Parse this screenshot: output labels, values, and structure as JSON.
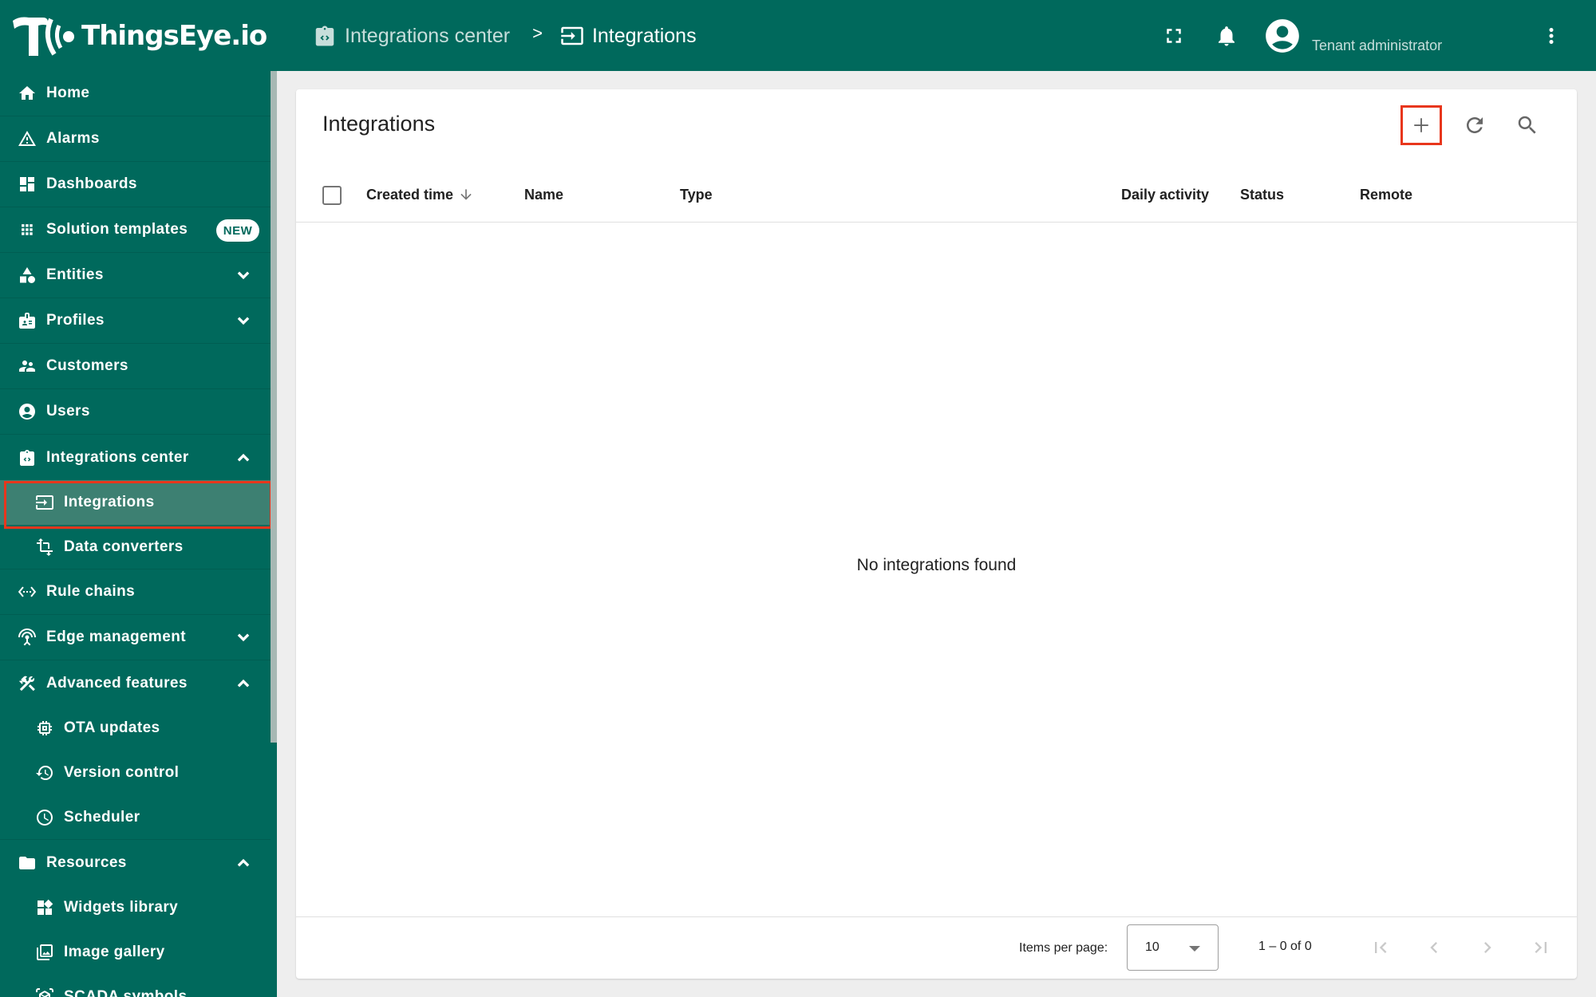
{
  "app": {
    "brand": "ThingsEye.io",
    "accent_color": "#00695c",
    "highlight_color": "#e8361c"
  },
  "header": {
    "breadcrumb": [
      {
        "label": "Integrations center",
        "icon": "integrations-center-icon"
      },
      {
        "label": "Integrations",
        "icon": "input-icon"
      }
    ],
    "separator": ">",
    "user_role": "Tenant administrator",
    "icons": [
      "fullscreen-icon",
      "notifications-bell-icon",
      "account-circle-icon",
      "more-vert-icon"
    ]
  },
  "sidebar": {
    "items": [
      {
        "label": "Home",
        "icon": "home-icon"
      },
      {
        "label": "Alarms",
        "icon": "warning-icon"
      },
      {
        "label": "Dashboards",
        "icon": "dashboard-icon"
      },
      {
        "label": "Solution templates",
        "icon": "apps-icon",
        "badge": "NEW"
      },
      {
        "label": "Entities",
        "icon": "category-icon",
        "expand": "down"
      },
      {
        "label": "Profiles",
        "icon": "badge-icon",
        "expand": "down"
      },
      {
        "label": "Customers",
        "icon": "supervisor-account-icon"
      },
      {
        "label": "Users",
        "icon": "account-circle-icon"
      },
      {
        "label": "Integrations center",
        "icon": "integrations-center-icon",
        "expand": "up"
      },
      {
        "label": "Integrations",
        "icon": "input-icon",
        "sub": true,
        "active": true
      },
      {
        "label": "Data converters",
        "icon": "transform-icon",
        "sub": true
      },
      {
        "label": "Rule chains",
        "icon": "settings-ethernet-icon"
      },
      {
        "label": "Edge management",
        "icon": "settings-input-antenna-icon",
        "expand": "down"
      },
      {
        "label": "Advanced features",
        "icon": "construction-icon",
        "expand": "up"
      },
      {
        "label": "OTA updates",
        "icon": "memory-icon",
        "sub": true
      },
      {
        "label": "Version control",
        "icon": "history-icon",
        "sub": true
      },
      {
        "label": "Scheduler",
        "icon": "schedule-icon",
        "sub": true
      },
      {
        "label": "Resources",
        "icon": "folder-icon",
        "expand": "up"
      },
      {
        "label": "Widgets library",
        "icon": "widgets-icon",
        "sub": true
      },
      {
        "label": "Image gallery",
        "icon": "photo-library-icon",
        "sub": true
      },
      {
        "label": "SCADA symbols",
        "icon": "view-in-ar-icon",
        "sub": true
      }
    ]
  },
  "main": {
    "title": "Integrations",
    "actions": [
      {
        "name": "add",
        "icon": "add-icon"
      },
      {
        "name": "refresh",
        "icon": "refresh-icon"
      },
      {
        "name": "search",
        "icon": "search-icon"
      }
    ],
    "columns": [
      "Created time",
      "Name",
      "Type",
      "Daily activity",
      "Status",
      "Remote"
    ],
    "sort": {
      "column": "Created time",
      "direction": "descending"
    },
    "empty_message": "No integrations found",
    "pagination": {
      "items_per_page_label": "Items per page:",
      "items_per_page": "10",
      "range": "1 – 0 of 0"
    }
  }
}
